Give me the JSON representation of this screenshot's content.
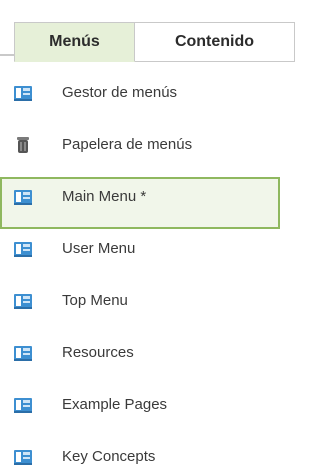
{
  "tabs": [
    {
      "label": "Menús",
      "active": true
    },
    {
      "label": "Contenido",
      "active": false
    }
  ],
  "items": [
    {
      "label": "Gestor de menús",
      "icon": "menu-manager-icon",
      "selected": false
    },
    {
      "label": "Papelera de menús",
      "icon": "trash-icon",
      "selected": false
    },
    {
      "label": "Main Menu *",
      "icon": "menu-icon",
      "selected": true
    },
    {
      "label": "User Menu",
      "icon": "menu-icon",
      "selected": false
    },
    {
      "label": "Top Menu",
      "icon": "menu-icon",
      "selected": false
    },
    {
      "label": "Resources",
      "icon": "menu-icon",
      "selected": false
    },
    {
      "label": "Example Pages",
      "icon": "menu-icon",
      "selected": false
    },
    {
      "label": "Key Concepts",
      "icon": "menu-icon",
      "selected": false
    }
  ],
  "colors": {
    "active_tab_bg": "#e6f0d8",
    "selected_border": "#8fb85f",
    "selected_bg": "#f1f6ea",
    "icon_blue": "#3d8fd1"
  }
}
